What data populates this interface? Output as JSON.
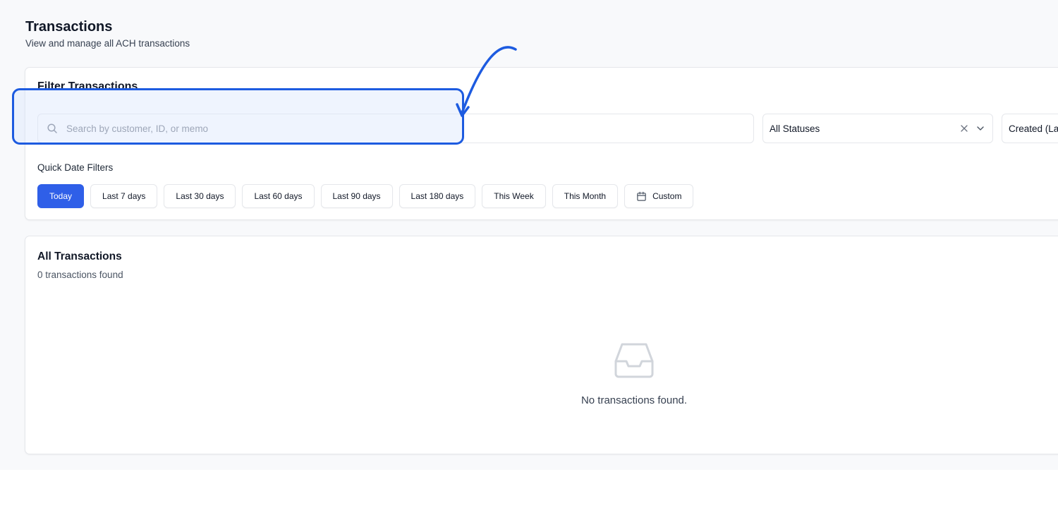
{
  "header": {
    "title": "Transactions",
    "subtitle": "View and manage all ACH transactions"
  },
  "filters": {
    "title": "Filter Transactions",
    "search": {
      "placeholder": "Search by customer, ID, or memo",
      "value": ""
    },
    "status": {
      "selected": "All Statuses"
    },
    "sort": {
      "selected": "Created (Latest)"
    },
    "quick_date_label": "Quick Date Filters",
    "quick_dates": [
      {
        "label": "Today",
        "active": true
      },
      {
        "label": "Last 7 days",
        "active": false
      },
      {
        "label": "Last 30 days",
        "active": false
      },
      {
        "label": "Last 60 days",
        "active": false
      },
      {
        "label": "Last 90 days",
        "active": false
      },
      {
        "label": "Last 180 days",
        "active": false
      },
      {
        "label": "This Week",
        "active": false
      },
      {
        "label": "This Month",
        "active": false
      },
      {
        "label": "Custom",
        "active": false,
        "icon": "calendar-icon"
      }
    ]
  },
  "transactions": {
    "title": "All Transactions",
    "count_text": "0 transactions found",
    "empty_icon": "inbox-icon",
    "empty_text": "No transactions found."
  },
  "colors": {
    "primary": "#2f5fe8",
    "annotation": "#1d5be0",
    "background": "#f8f9fb"
  }
}
